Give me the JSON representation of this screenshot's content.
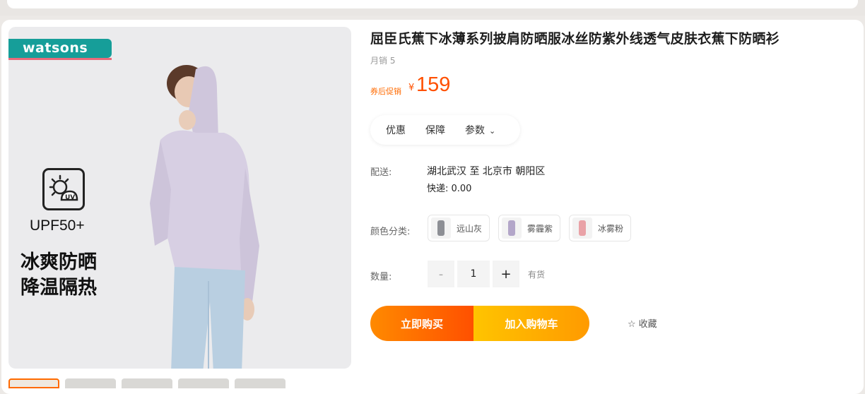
{
  "gallery": {
    "brand": "watsons",
    "upf_label": "UPF50+",
    "promo_lines": [
      "冰爽防晒",
      "降温隔热"
    ],
    "uv_icon_text": "UV"
  },
  "product": {
    "title": "屈臣氏蕉下冰薄系列披肩防晒服冰丝防紫外线透气皮肤衣蕉下防晒衫",
    "sales": "月销 5",
    "price_label": "券后促销",
    "currency": "¥",
    "price": "159"
  },
  "tabs": [
    {
      "label": "优惠"
    },
    {
      "label": "保障"
    },
    {
      "label": "参数"
    }
  ],
  "shipping": {
    "label": "配送:",
    "route": "湖北武汉 至 北京市 朝阳区",
    "fee": "快递: 0.00"
  },
  "colors": {
    "label": "颜色分类:",
    "options": [
      {
        "label": "远山灰",
        "color": "#8d8f95"
      },
      {
        "label": "雾霾紫",
        "color": "#b3a6c9"
      },
      {
        "label": "冰雾粉",
        "color": "#e9a2a7"
      }
    ]
  },
  "quantity": {
    "label": "数量:",
    "minus": "-",
    "value": "1",
    "plus": "+",
    "stock": "有货"
  },
  "actions": {
    "buy_now": "立即购买",
    "add_to_cart": "加入购物车",
    "favorite": "收藏"
  },
  "colors_theme": {
    "accent": "#ff5000",
    "brand": "#169e99"
  }
}
